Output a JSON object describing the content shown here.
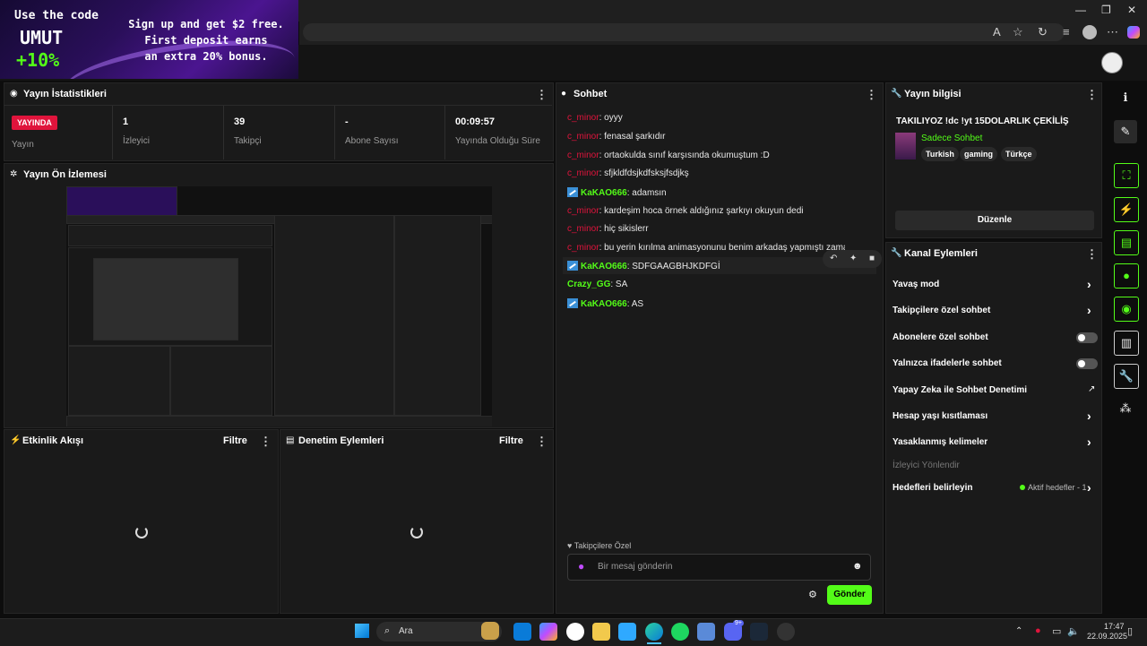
{
  "ad": {
    "line1": "Use the code",
    "code": "UMUT",
    "bonus": "+10%",
    "line2": "Sign up and get $2 free.",
    "line3": "First deposit earns",
    "line4": "an extra 20% bonus."
  },
  "stats": {
    "title": "Yayın İstatistikleri",
    "live_badge": "YAYINDA",
    "status_label": "Yayın",
    "viewers_value": "1",
    "viewers_label": "İzleyici",
    "followers_value": "39",
    "followers_label": "Takipçi",
    "subs_value": "-",
    "subs_label": "Abone Sayısı",
    "uptime_value": "00:09:57",
    "uptime_label": "Yayında Olduğu Süre"
  },
  "preview": {
    "title": "Yayın Ön İzlemesi"
  },
  "activity": {
    "title": "Etkinlik Akışı",
    "filter": "Filtre"
  },
  "moderation": {
    "title": "Denetim Eylemleri",
    "filter": "Filtre"
  },
  "chat": {
    "title": "Sohbet",
    "messages": [
      {
        "user": "c_minor",
        "text": ": oyyy"
      },
      {
        "user": "c_minor",
        "text": ": fenasal şarkıdır"
      },
      {
        "user": "c_minor",
        "text": ": ortaokulda sınıf karşısında okumuştum :D"
      },
      {
        "user": "c_minor",
        "text": ": sfjkldfdsjkdfsksjfsdjkş"
      },
      {
        "user": "KaKAO666",
        "text": ": adamsın"
      },
      {
        "user": "c_minor",
        "text": ": kardeşim hoca örnek aldığınız şarkıyı okuyun dedi"
      },
      {
        "user": "c_minor",
        "text": ": hiç sikislerr"
      },
      {
        "user": "c_minor",
        "text": ": bu yerin kırılma animasyonunu benim arkadaş yapmıştı zamanında"
      },
      {
        "user": "KaKAO666",
        "text": ": SDFGAAGBHJKDFGİ"
      },
      {
        "user": "Crazy_GG",
        "text": ": SA"
      },
      {
        "user": "KaKAO666",
        "text": ": AS"
      }
    ],
    "mode_label": "Takipçilere Özel",
    "input_placeholder": "Bir mesaj gönderin",
    "send_label": "Gönder"
  },
  "stream_info": {
    "title": "Yayın bilgisi",
    "stream_title": "TAKILIYOZ !dc !yt 15DOLARLIK ÇEKİLİŞ",
    "category": "Sadece Sohbet",
    "tags": [
      "Turkish",
      "gaming",
      "Türkçe"
    ],
    "edit_label": "Düzenle"
  },
  "channel_actions": {
    "title": "Kanal Eylemleri",
    "slow_mode": "Yavaş mod",
    "followers_only": "Takipçilere özel sohbet",
    "subs_only": "Abonelere özel sohbet",
    "emotes_only": "Yalnızca ifadelerle sohbet",
    "ai_moderation": "Yapay Zeka ile Sohbet Denetimi",
    "age_restriction": "Hesap yaşı kısıtlaması",
    "banned_words": "Yasaklanmış kelimeler",
    "redirect": "İzleyici Yönlendir",
    "goals": "Hedefleri belirleyin",
    "goals_status": "Aktif hedefler - 1"
  },
  "taskbar": {
    "search": "Ara",
    "time": "17:47",
    "date": "22.09.2025",
    "discord_badge": "9+"
  },
  "colors": {
    "accent": "#53fc18",
    "live": "#e0143c",
    "panel": "#1a1a1a"
  }
}
